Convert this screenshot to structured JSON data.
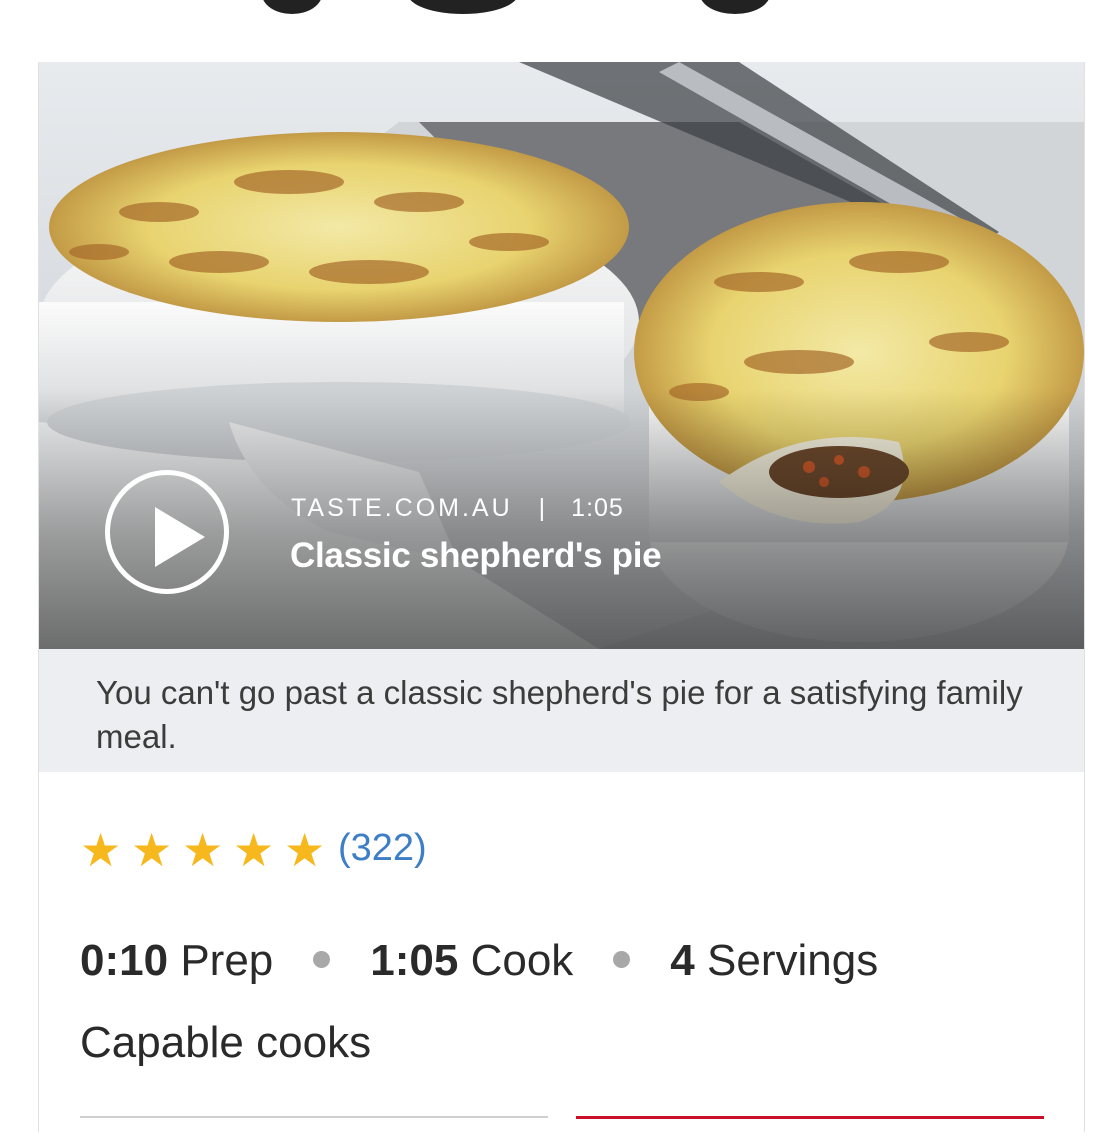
{
  "video": {
    "source": "TASTE.COM.AU",
    "separator": "|",
    "duration": "1:05",
    "title": "Classic shepherd's pie"
  },
  "description": "You can't go past a classic shepherd's pie for a satisfying family meal.",
  "rating": {
    "stars": 5,
    "count": "(322)",
    "star_color": "#f6b81c",
    "count_color": "#3d7ec7"
  },
  "stats": {
    "prep_time": "0:10",
    "prep_label": "Prep",
    "cook_time": "1:05",
    "cook_label": "Cook",
    "servings": "4",
    "servings_label": "Servings"
  },
  "difficulty": "Capable cooks",
  "colors": {
    "accent": "#c8102e"
  }
}
